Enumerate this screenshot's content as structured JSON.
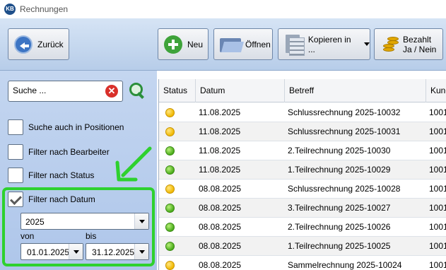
{
  "window": {
    "logo": "KB",
    "title": "Rechnungen"
  },
  "toolbar": {
    "back_label": "Zurück",
    "new_label": "Neu",
    "open_label": "Öffnen",
    "copy_label": "Kopieren in ...",
    "paid_label_line1": "Bezahlt",
    "paid_label_line2": "Ja / Nein"
  },
  "filters": {
    "search_placeholder": "Suche ...",
    "clear_symbol": "✕",
    "search_positions": "Suche auch in Positionen",
    "by_editor": "Filter nach Bearbeiter",
    "by_status": "Filter nach Status",
    "by_date": "Filter nach Datum",
    "by_date_checked": true,
    "year_value": "2025",
    "from_label": "von",
    "to_label": "bis",
    "from_value": "01.01.2025",
    "to_value": "31.12.2025"
  },
  "table": {
    "headers": {
      "status": "Status",
      "date": "Datum",
      "subject": "Betreff",
      "customer": "Kund"
    },
    "rows": [
      {
        "status": "yellow",
        "date": "11.08.2025",
        "subject": "Schlussrechnung 2025-10032",
        "customer": "1001"
      },
      {
        "status": "yellow",
        "date": "11.08.2025",
        "subject": "Schlussrechnung 2025-10031",
        "customer": "1001"
      },
      {
        "status": "green",
        "date": "11.08.2025",
        "subject": "2.Teilrechnung 2025-10030",
        "customer": "1001"
      },
      {
        "status": "green",
        "date": "11.08.2025",
        "subject": "1.Teilrechnung 2025-10029",
        "customer": "1001"
      },
      {
        "status": "yellow",
        "date": "08.08.2025",
        "subject": "Schlussrechnung 2025-10028",
        "customer": "1001"
      },
      {
        "status": "green",
        "date": "08.08.2025",
        "subject": "3.Teilrechnung 2025-10027",
        "customer": "1001"
      },
      {
        "status": "green",
        "date": "08.08.2025",
        "subject": "2.Teilrechnung 2025-10026",
        "customer": "1001"
      },
      {
        "status": "green",
        "date": "08.08.2025",
        "subject": "1.Teilrechnung 2025-10025",
        "customer": "1001"
      },
      {
        "status": "yellow",
        "date": "08.08.2025",
        "subject": "Sammelrechnung 2025-10024",
        "customer": "1001"
      }
    ]
  },
  "colors": {
    "highlight": "#2ed12e",
    "status_yellow": "#f0b800",
    "status_green": "#4aac1a"
  }
}
